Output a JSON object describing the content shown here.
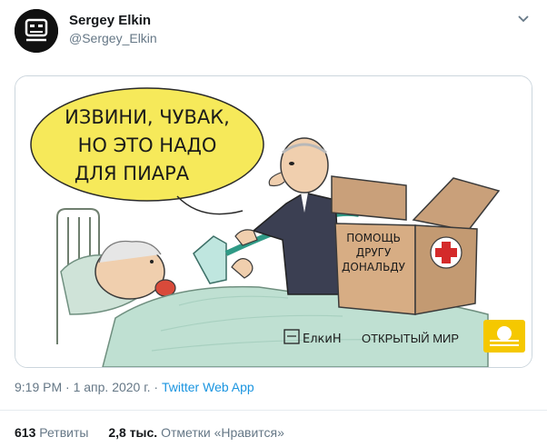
{
  "author": {
    "name": "Sergey Elkin",
    "handle": "@Sergey_Elkin"
  },
  "cartoon": {
    "speech": [
      "ИЗВИНИ, ЧУВАК,",
      "НО ЭТО НАДО",
      "ДЛЯ ПИАРА"
    ],
    "box_label": [
      "ПОМОЩЬ",
      "ДРУГУ",
      "ДОНАЛЬДУ"
    ],
    "signature": "ЕлкиН",
    "brand": "ОТКРЫТЫЙ МИР"
  },
  "meta": {
    "time": "9:19 PM",
    "sep1": "·",
    "date": "1 апр. 2020 г.",
    "sep2": "·",
    "source": "Twitter Web App"
  },
  "stats": {
    "retweets_count": "613",
    "retweets_label": "Ретвиты",
    "likes_count": "2,8 тыс.",
    "likes_label": "Отметки «Нравится»"
  },
  "colors": {
    "link": "#1b95e0",
    "muted": "#657786",
    "bubble": "#f6e95a",
    "logo": "#f5c800",
    "blanket": "#bfe0d2"
  },
  "icons": {
    "caret": "chevron-down-icon",
    "avatar": "robot-face-icon"
  }
}
